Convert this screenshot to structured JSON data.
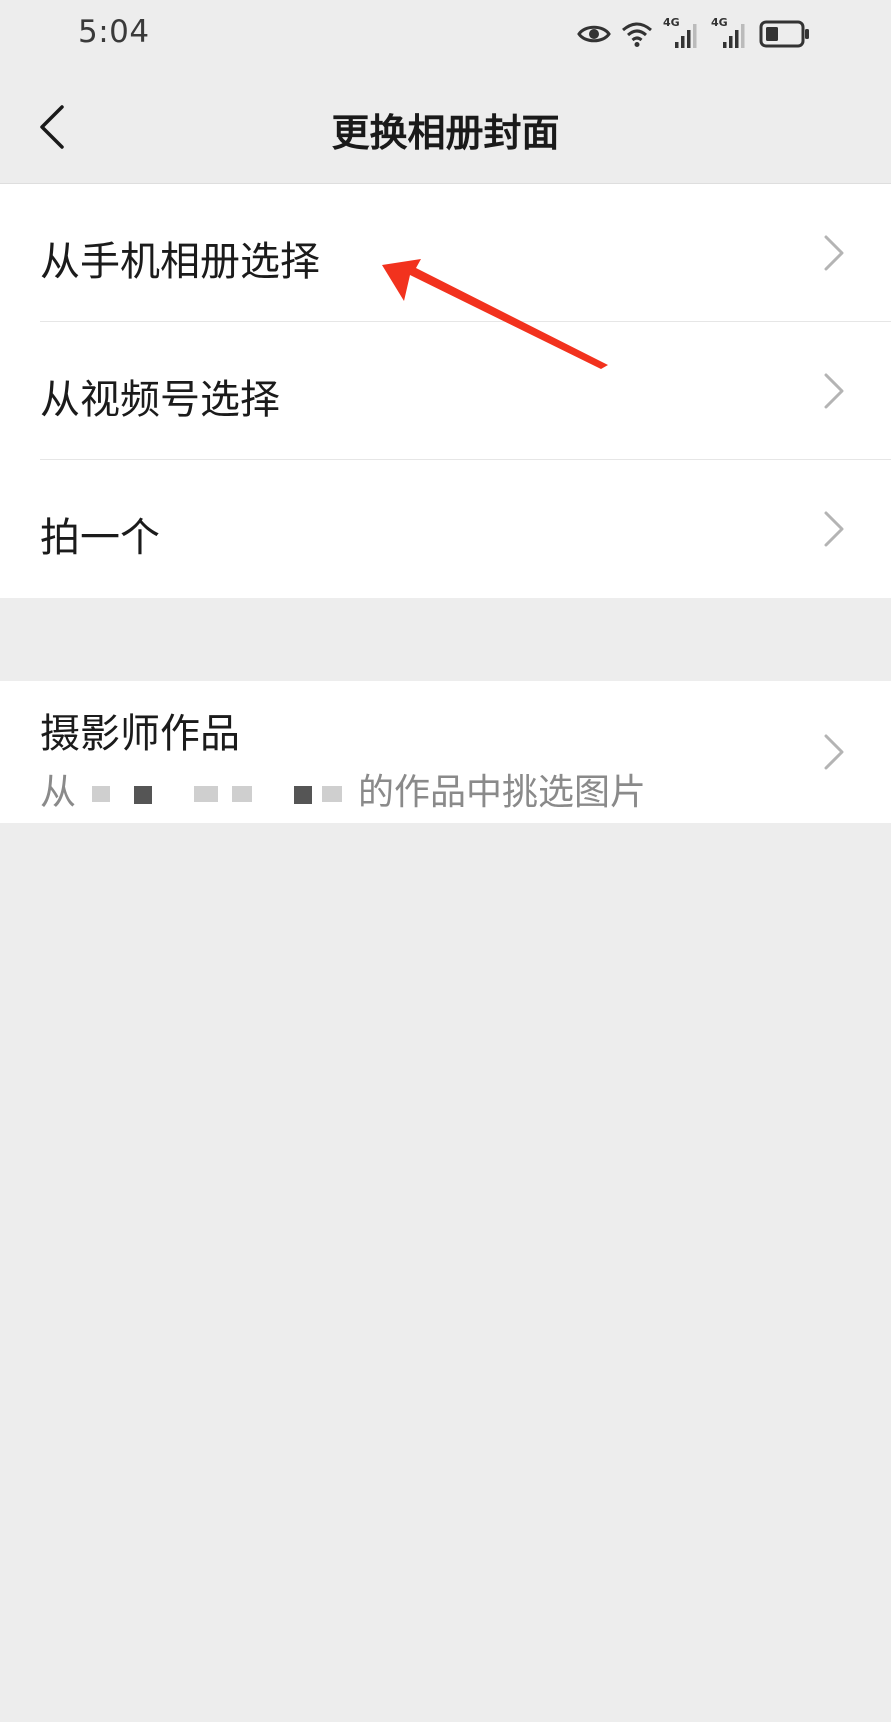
{
  "status_bar": {
    "time": "5:04",
    "network_1": "4G",
    "network_2": "4G",
    "icons": [
      "eye-icon",
      "wifi-icon",
      "signal-4g-icon",
      "signal-4g-icon",
      "battery-icon"
    ]
  },
  "nav": {
    "title": "更换相册封面",
    "back_icon": "chevron-left-icon"
  },
  "menu_group_1": [
    {
      "label": "从手机相册选择"
    },
    {
      "label": "从视频号选择"
    },
    {
      "label": "拍一个"
    }
  ],
  "menu_group_2": {
    "title": "摄影师作品",
    "subtitle_prefix": "从",
    "subtitle_suffix": "的作品中挑选图片"
  },
  "colors": {
    "background": "#ededed",
    "cell_background": "#ffffff",
    "annotation_arrow": "#f2321e"
  }
}
